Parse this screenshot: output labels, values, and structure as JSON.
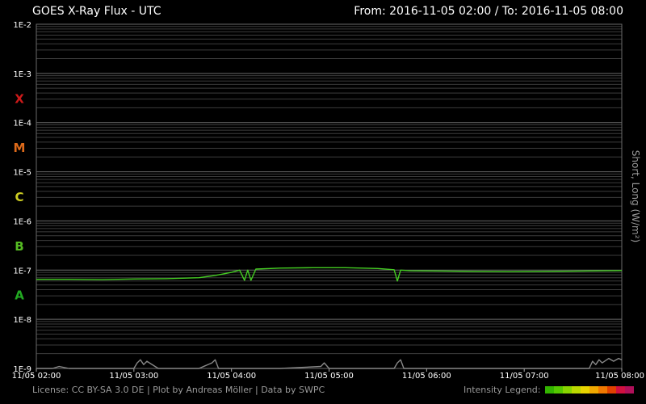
{
  "header": {
    "title": "GOES X-Ray Flux - UTC",
    "range": "From: 2016-11-05 02:00  /  To: 2016-11-05 08:00"
  },
  "footer": {
    "license": "License: CC BY-SA 3.0 DE | Plot by Andreas Möller | Data by SWPC",
    "legend_label": "Intensity Legend:",
    "legend_colors": [
      "#33b400",
      "#55c800",
      "#88d400",
      "#bbd800",
      "#e8d400",
      "#f0a800",
      "#f07800",
      "#e04000",
      "#d01040",
      "#b0105a"
    ]
  },
  "chart_data": {
    "type": "line",
    "title": "GOES X-Ray Flux - UTC",
    "ylabel": "Short, Long (W/m²)",
    "yscale": "log",
    "ylim": [
      1e-09,
      0.01
    ],
    "yticks": [
      "1E-9",
      "1E-8",
      "1E-7",
      "1E-6",
      "1E-5",
      "1E-4",
      "1E-3",
      "1E-2"
    ],
    "flare_classes": [
      {
        "label": "A",
        "color": "#22aa22"
      },
      {
        "label": "B",
        "color": "#55bb22"
      },
      {
        "label": "C",
        "color": "#cccc22"
      },
      {
        "label": "M",
        "color": "#dd6a1a"
      },
      {
        "label": "X",
        "color": "#cc1a1a"
      }
    ],
    "xlim": [
      "2016-11-05 02:00",
      "2016-11-05 08:00"
    ],
    "xticks": [
      "11/05 02:00",
      "11/05 03:00",
      "11/05 04:00",
      "11/05 05:00",
      "11/05 06:00",
      "11/05 07:00",
      "11/05 08:00"
    ],
    "grid": true,
    "series": [
      {
        "color": "#44cc22",
        "x": [
          "02:00",
          "02:20",
          "02:40",
          "03:00",
          "03:20",
          "03:40",
          "03:50",
          "04:00",
          "04:05",
          "04:08",
          "04:10",
          "04:12",
          "04:15",
          "04:30",
          "04:50",
          "05:10",
          "05:30",
          "05:40",
          "05:42",
          "05:44",
          "05:50",
          "06:10",
          "06:30",
          "06:50",
          "07:10",
          "07:30",
          "07:50",
          "08:00"
        ],
        "y": [
          6.5e-08,
          6.5e-08,
          6.4e-08,
          6.6e-08,
          6.7e-08,
          7e-08,
          7.8e-08,
          9e-08,
          1e-07,
          6.2e-08,
          1e-07,
          6.2e-08,
          1.05e-07,
          1.1e-07,
          1.12e-07,
          1.12e-07,
          1.08e-07,
          1.02e-07,
          6e-08,
          1e-07,
          9.7e-08,
          9.6e-08,
          9.4e-08,
          9.3e-08,
          9.4e-08,
          9.5e-08,
          9.7e-08,
          9.8e-08
        ]
      },
      {
        "color": "#888888",
        "x": [
          "02:00",
          "02:10",
          "02:14",
          "02:20",
          "02:50",
          "03:00",
          "03:02",
          "03:04",
          "03:06",
          "03:08",
          "03:15",
          "03:40",
          "03:48",
          "03:50",
          "03:52",
          "04:30",
          "04:55",
          "04:57",
          "05:00",
          "05:40",
          "05:42",
          "05:44",
          "05:46",
          "06:30",
          "07:40",
          "07:42",
          "07:44",
          "07:46",
          "07:48",
          "07:52",
          "07:55",
          "07:58",
          "08:00"
        ],
        "y": [
          1e-09,
          1e-09,
          1.1e-09,
          1e-09,
          1e-09,
          1e-09,
          1.3e-09,
          1.5e-09,
          1.2e-09,
          1.4e-09,
          1e-09,
          1e-09,
          1.3e-09,
          1.5e-09,
          1e-09,
          1e-09,
          1.1e-09,
          1.3e-09,
          1e-09,
          1e-09,
          1.3e-09,
          1.5e-09,
          1e-09,
          1e-09,
          1e-09,
          1.4e-09,
          1.2e-09,
          1.5e-09,
          1.3e-09,
          1.6e-09,
          1.4e-09,
          1.6e-09,
          1.5e-09
        ]
      }
    ]
  }
}
